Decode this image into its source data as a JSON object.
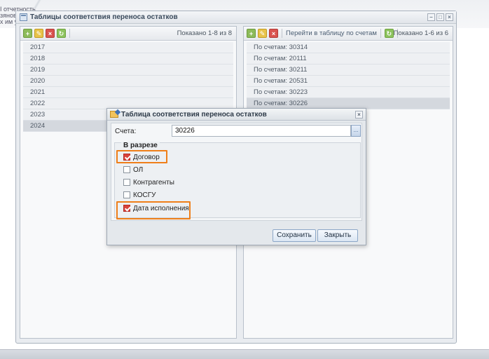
{
  "background": {
    "lines": [
      "I отчетность",
      "зянов",
      "х им у"
    ]
  },
  "window": {
    "title": "Таблицы соответствия переноса остатков",
    "controls": [
      "–",
      "□",
      "×"
    ]
  },
  "left_panel": {
    "info": "Показано 1-8 из 8",
    "rows": [
      "2017",
      "2018",
      "2019",
      "2020",
      "2021",
      "2022",
      "2023",
      "2024"
    ],
    "selected_index": 7
  },
  "right_panel": {
    "link": "Перейти в таблицу по счетам",
    "info": "Показано 1-6 из 6",
    "rows": [
      "По счетам: 30314",
      "По счетам: 20111",
      "По счетам: 30211",
      "По счетам: 20531",
      "По счетам: 30223",
      "По счетам: 30226"
    ],
    "selected_index": 5
  },
  "modal": {
    "title": "Таблица соответствия переноса остатков",
    "close": "×",
    "field_label": "Счета:",
    "field_value": "30226",
    "field_button": "...",
    "group_title": "В разрезе",
    "options": [
      {
        "label": "Договор",
        "checked": true,
        "highlighted": true
      },
      {
        "label": "ОЛ",
        "checked": false,
        "highlighted": false
      },
      {
        "label": "Контрагенты",
        "checked": false,
        "highlighted": false
      },
      {
        "label": "КОСГУ",
        "checked": false,
        "highlighted": false
      },
      {
        "label": "Дата исполнения",
        "checked": true,
        "highlighted": true
      }
    ],
    "save_label": "Сохранить",
    "close_label": "Закрыть"
  },
  "colors": {
    "highlight": "#ef7f1a",
    "checked": "#d9423b"
  }
}
